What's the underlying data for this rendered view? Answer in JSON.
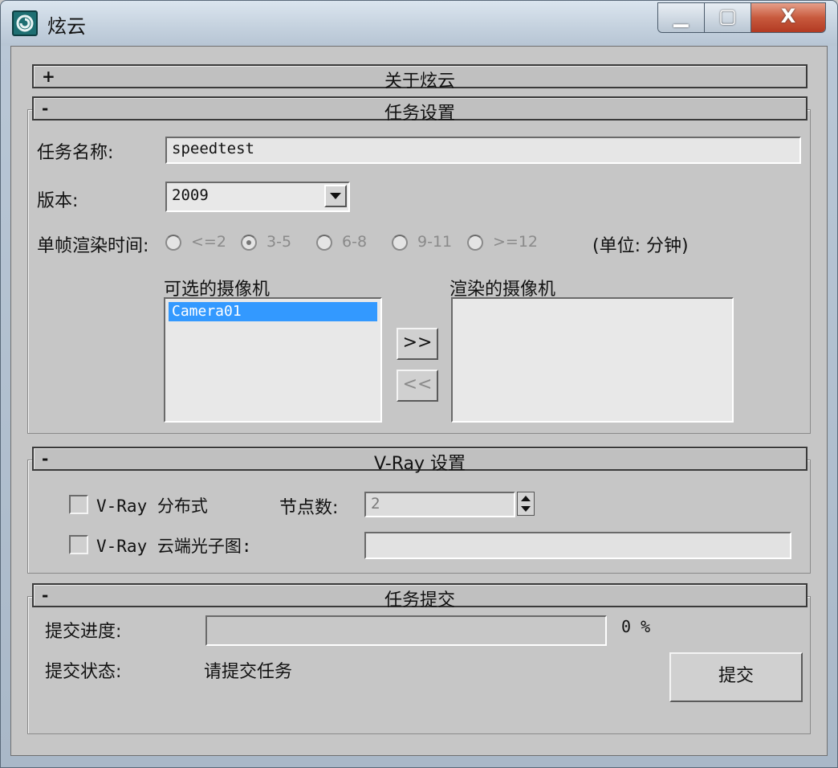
{
  "window": {
    "title": "炫云",
    "controls": {
      "minimize": "▁",
      "maximize": "▢",
      "close": "X"
    }
  },
  "rollouts": {
    "about": {
      "sign": "+",
      "title": "关于炫云"
    },
    "task_settings": {
      "sign": "-",
      "title": "任务设置",
      "task_name_label": "任务名称:",
      "task_name_value": "speedtest",
      "version_label": "版本:",
      "version_value": "2009",
      "frame_time_label": "单帧渲染时间:",
      "frame_time_options": [
        "<=2",
        "3-5",
        "6-8",
        "9-11",
        ">=12"
      ],
      "frame_time_selected": "3-5",
      "unit_note": "(单位: 分钟)",
      "available_cameras_label": "可选的摄像机",
      "available_cameras": [
        "Camera01"
      ],
      "render_cameras_label": "渲染的摄像机",
      "render_cameras": [],
      "add_button": ">>",
      "remove_button": "<<"
    },
    "vray_settings": {
      "sign": "-",
      "title": "V-Ray 设置",
      "distributed_label": "V-Ray 分布式",
      "distributed_checked": false,
      "nodes_label": "节点数:",
      "nodes_value": "2",
      "cloud_photon_label": "V-Ray 云端光子图:",
      "cloud_photon_checked": false,
      "cloud_photon_value": ""
    },
    "task_submit": {
      "sign": "-",
      "title": "任务提交",
      "progress_label": "提交进度:",
      "progress_percent": "0 %",
      "progress_fraction": 0,
      "status_label": "提交状态:",
      "status_value": "请提交任务",
      "submit_button": "提交"
    }
  },
  "colors": {
    "selection": "#3399ff",
    "panel": "#c6c6c6",
    "close_button": "#c85a3e"
  }
}
